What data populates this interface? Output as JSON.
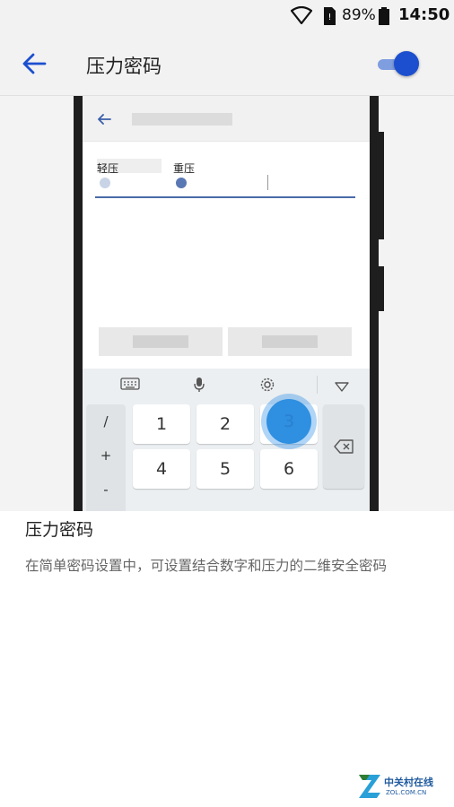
{
  "status_bar": {
    "battery_percent": "89%",
    "time": "14:50",
    "icons": [
      "wifi-icon",
      "sim-icon",
      "battery-icon"
    ]
  },
  "app_bar": {
    "title": "压力密码",
    "toggle_on": true,
    "accent_color": "#1c4fcf"
  },
  "illustration": {
    "pressure_labels": {
      "light": "轻压",
      "heavy": "重压"
    },
    "keypad": {
      "digits": [
        "1",
        "2",
        "3",
        "4",
        "5",
        "6"
      ],
      "side_keys": [
        "/",
        "+",
        "-"
      ]
    }
  },
  "description": {
    "title": "压力密码",
    "body": "在简单密码设置中，可设置结合数字和压力的二维安全密码"
  },
  "watermark": {
    "cn": "中关村在线",
    "en": "ZOL.COM.CN"
  }
}
